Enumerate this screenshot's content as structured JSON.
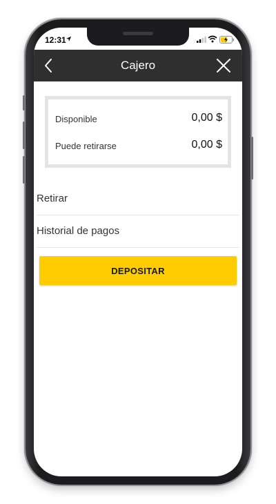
{
  "status_bar": {
    "time": "12:31",
    "icons": [
      "location-arrow-icon",
      "signal-icon",
      "wifi-icon",
      "battery-charging-icon"
    ],
    "battery_color": "#ffcc00"
  },
  "header": {
    "title": "Cajero",
    "background": "#2f2f2f",
    "left_icon": "chevron-left-icon",
    "right_icon": "close-icon"
  },
  "balances": [
    {
      "label": "Disponible",
      "value": "0,00 $"
    },
    {
      "label": "Puede retirarse",
      "value": "0,00 $"
    }
  ],
  "menu": [
    {
      "label": "Retirar"
    },
    {
      "label": "Historial de pagos"
    }
  ],
  "deposit_button": {
    "label": "DEPOSITAR",
    "color": "#ffcc00"
  }
}
